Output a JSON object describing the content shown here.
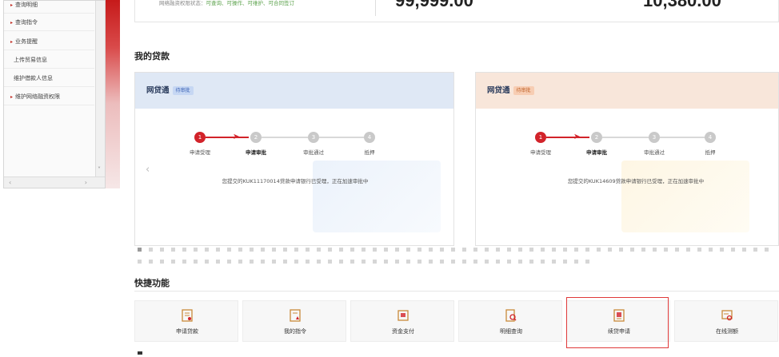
{
  "sidebar": {
    "items": [
      {
        "label": "查询明细",
        "arrow": true
      },
      {
        "label": "查询指令",
        "arrow": true
      },
      {
        "label": "业务提醒",
        "arrow": true
      },
      {
        "label": "上传贸易信息",
        "arrow": false
      },
      {
        "label": "维护借款人信息",
        "arrow": false
      },
      {
        "label": "维护网络融资权限",
        "arrow": true
      }
    ]
  },
  "status": {
    "prefix": "网络融资权限状态：",
    "value": "可查询、可操作、可维护、可合同签订",
    "amount1": "99,999.00",
    "amount2": "10,380.00"
  },
  "loans_section": {
    "title": "我的贷款"
  },
  "cards": [
    {
      "product": "网贷通",
      "tag": "待审批",
      "steps": [
        "申请受理",
        "申请审批",
        "审批通过",
        "抵押"
      ],
      "message": "您提交的KUK11170014贷款申请银行已受理，正在加速审批中"
    },
    {
      "product": "网贷通",
      "tag": "待审批",
      "steps": [
        "申请受理",
        "申请审批",
        "审批通过",
        "抵押"
      ],
      "message": "您提交的KUK14609贷款申请银行已受理，正在加速审批中"
    }
  ],
  "step_numbers": [
    "1",
    "2",
    "3",
    "4"
  ],
  "quick": {
    "title": "快捷功能",
    "items": [
      {
        "label": "申请贷款",
        "icon": "apply-loan-icon"
      },
      {
        "label": "我的指令",
        "icon": "my-instruction-icon"
      },
      {
        "label": "资金支付",
        "icon": "payment-icon"
      },
      {
        "label": "明细查询",
        "icon": "detail-query-icon"
      },
      {
        "label": "续贷申请",
        "icon": "renewal-icon"
      },
      {
        "label": "在线测额",
        "icon": "online-quota-icon"
      }
    ]
  },
  "colors": {
    "accent": "#d2232a",
    "icon": "#c98a3a",
    "highlight": "#e03a3a"
  }
}
